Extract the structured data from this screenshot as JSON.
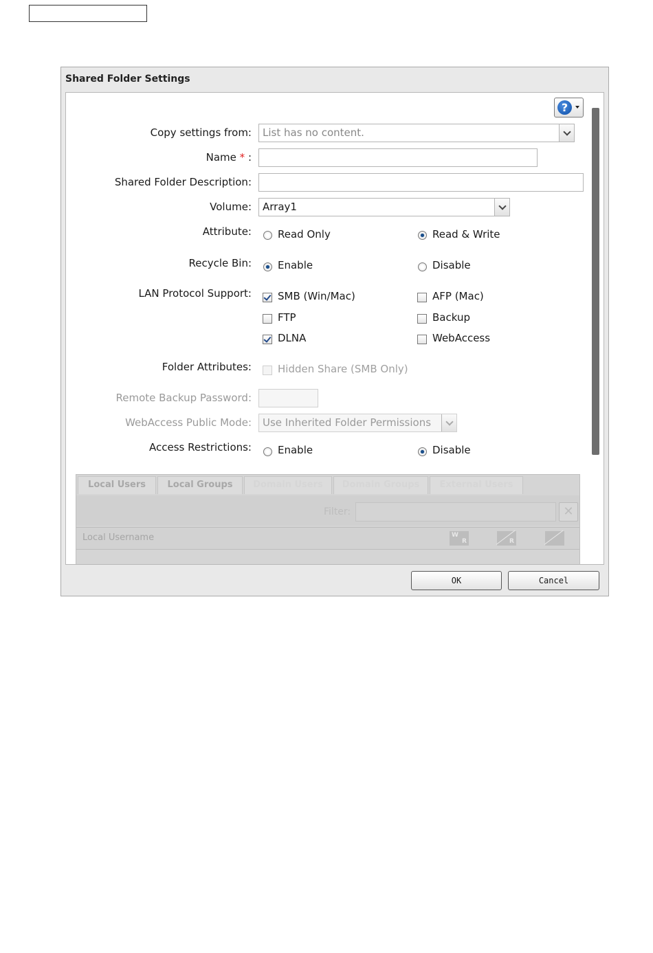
{
  "dialog": {
    "title": "Shared Folder Settings",
    "help_icon": "question-icon"
  },
  "form": {
    "copy_settings": {
      "label": "Copy settings from:",
      "value": "List has no content."
    },
    "name": {
      "label": "Name",
      "required_mark": "*",
      "colon": ":",
      "value": ""
    },
    "description": {
      "label": "Shared Folder Description:",
      "value": ""
    },
    "volume": {
      "label": "Volume:",
      "value": "Array1"
    },
    "attribute": {
      "label": "Attribute:",
      "options": [
        "Read Only",
        "Read & Write"
      ],
      "selected": "Read & Write"
    },
    "recycle_bin": {
      "label": "Recycle Bin:",
      "options": [
        "Enable",
        "Disable"
      ],
      "selected": "Enable"
    },
    "lan_protocol": {
      "label": "LAN Protocol Support:",
      "options": [
        {
          "label": "SMB (Win/Mac)",
          "checked": true
        },
        {
          "label": "AFP (Mac)",
          "checked": false
        },
        {
          "label": "FTP",
          "checked": false
        },
        {
          "label": "Backup",
          "checked": false
        },
        {
          "label": "DLNA",
          "checked": true
        },
        {
          "label": "WebAccess",
          "checked": false
        }
      ]
    },
    "folder_attributes": {
      "label": "Folder Attributes:",
      "option": "Hidden Share (SMB Only)",
      "checked": false,
      "disabled": true
    },
    "remote_backup_password": {
      "label": "Remote Backup Password:",
      "value": "",
      "disabled": true
    },
    "webaccess_public_mode": {
      "label": "WebAccess Public Mode:",
      "value": "Use Inherited Folder Permissions",
      "disabled": true
    },
    "access_restrictions": {
      "label": "Access Restrictions:",
      "options": [
        "Enable",
        "Disable"
      ],
      "selected": "Disable"
    }
  },
  "access_tabs": {
    "tabs": [
      "Local Users",
      "Local Groups",
      "Domain Users",
      "Domain Groups",
      "External Users"
    ],
    "filter_label": "Filter:",
    "clear_icon": "close-icon",
    "column_header": "Local Username",
    "permission_icons": [
      {
        "name": "read-write-icon",
        "top": "W",
        "bottom": "R"
      },
      {
        "name": "read-only-icon",
        "top": "",
        "bottom": "R"
      },
      {
        "name": "no-access-icon",
        "top": "",
        "bottom": ""
      }
    ]
  },
  "buttons": {
    "ok": "OK",
    "cancel": "Cancel"
  }
}
